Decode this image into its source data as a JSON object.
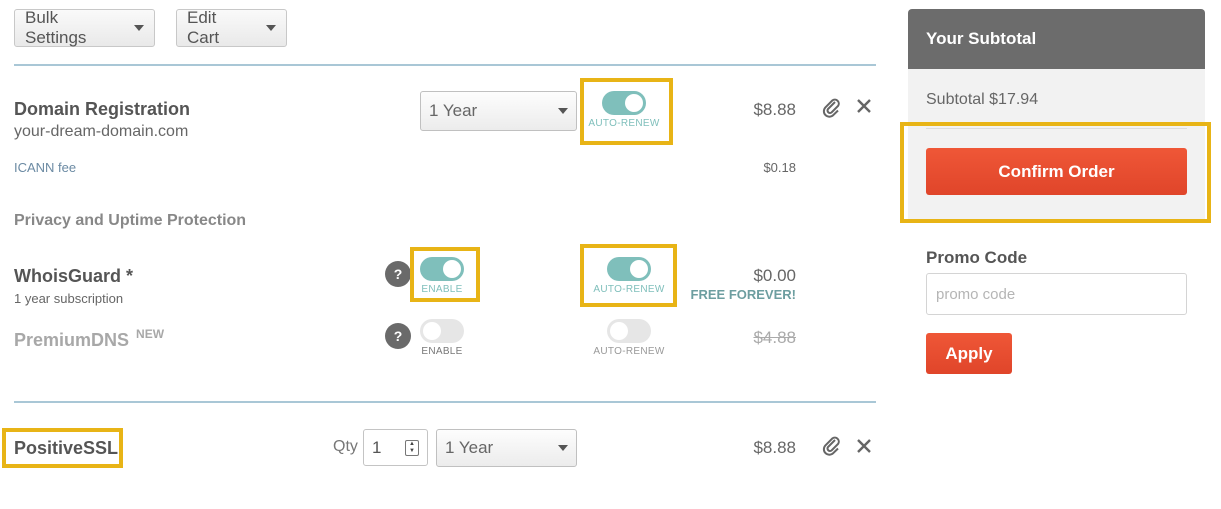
{
  "toolbar": {
    "bulk_settings": "Bulk Settings",
    "edit_cart": "Edit Cart"
  },
  "domain_registration": {
    "title": "Domain Registration",
    "domain": "your-dream-domain.com",
    "term": "1 Year",
    "auto_renew_label": "AUTO-RENEW",
    "auto_renew_on": true,
    "price": "$8.88",
    "icann_label": "ICANN fee",
    "icann_price": "$0.18"
  },
  "privacy": {
    "section_title": "Privacy and Uptime Protection"
  },
  "whoisguard": {
    "title": "WhoisGuard *",
    "subtitle": "1 year subscription",
    "help": "?",
    "enable_label": "ENABLE",
    "enable_on": true,
    "auto_renew_label": "AUTO-RENEW",
    "auto_renew_on": true,
    "price": "$0.00",
    "free_note": "FREE FOREVER!"
  },
  "premiumdns": {
    "title": "PremiumDNS",
    "badge": "NEW",
    "help": "?",
    "enable_label": "ENABLE",
    "enable_on": false,
    "auto_renew_label": "AUTO-RENEW",
    "auto_renew_on": false,
    "price": "$4.88"
  },
  "positivessl": {
    "title": "PositiveSSL",
    "qty_label": "Qty",
    "qty_value": "1",
    "term": "1 Year",
    "price": "$8.88"
  },
  "sidebar": {
    "header": "Your Subtotal",
    "subtotal": "Subtotal $17.94",
    "confirm_label": "Confirm Order",
    "promo_title": "Promo Code",
    "promo_placeholder": "promo code",
    "apply_label": "Apply"
  },
  "colors": {
    "accent": "#e8b416",
    "toggle_on": "#7fbfbb",
    "button": "#e84c30",
    "free_text": "#6d9ea0"
  }
}
